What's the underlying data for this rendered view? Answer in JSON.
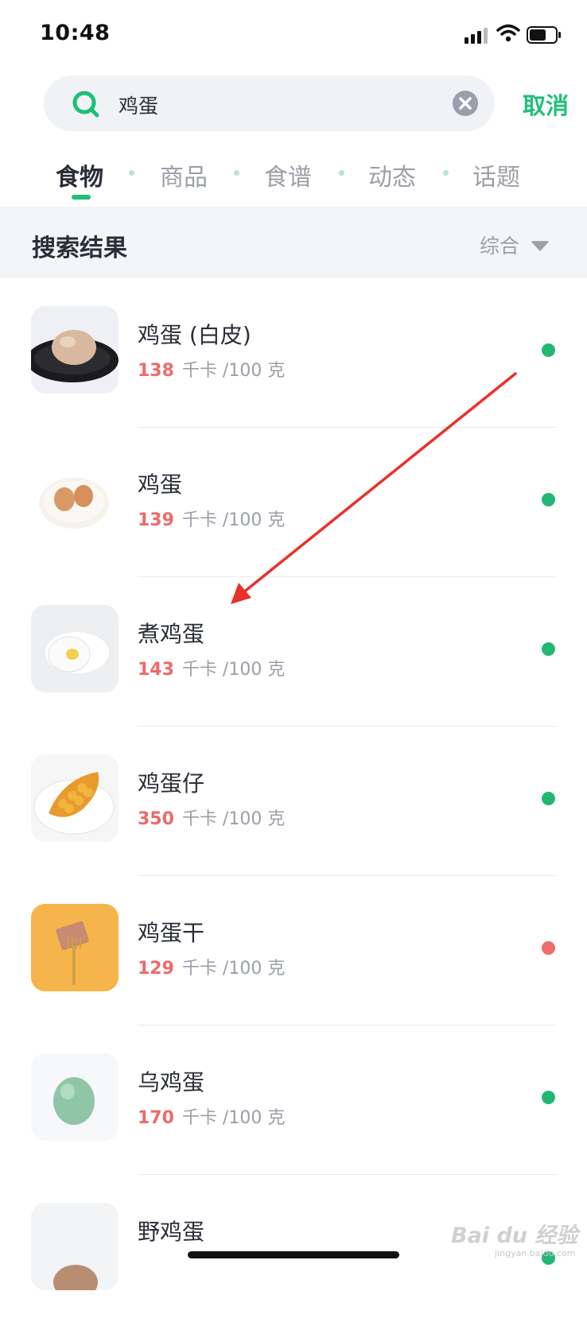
{
  "status_bar": {
    "time": "10:48"
  },
  "search": {
    "query": "鸡蛋",
    "cancel_label": "取消"
  },
  "tabs": [
    {
      "label": "食物",
      "active": true
    },
    {
      "label": "商品",
      "active": false
    },
    {
      "label": "食谱",
      "active": false
    },
    {
      "label": "动态",
      "active": false
    },
    {
      "label": "话题",
      "active": false
    }
  ],
  "results_header": {
    "title": "搜索结果",
    "sort_label": "综合"
  },
  "results": [
    {
      "name": "鸡蛋 (白皮)",
      "kcal": "138",
      "unit": "千卡 /100 克",
      "dot_color": "#22b873"
    },
    {
      "name": "鸡蛋",
      "kcal": "139",
      "unit": "千卡 /100 克",
      "dot_color": "#22b873"
    },
    {
      "name": "煮鸡蛋",
      "kcal": "143",
      "unit": "千卡 /100 克",
      "dot_color": "#22b873"
    },
    {
      "name": "鸡蛋仔",
      "kcal": "350",
      "unit": "千卡 /100 克",
      "dot_color": "#22b873"
    },
    {
      "name": "鸡蛋干",
      "kcal": "129",
      "unit": "千卡 /100 克",
      "dot_color": "#f06b6b"
    },
    {
      "name": "乌鸡蛋",
      "kcal": "170",
      "unit": "千卡 /100 克",
      "dot_color": "#22b873"
    },
    {
      "name": "野鸡蛋",
      "kcal": "",
      "unit": "",
      "dot_color": "#22b873"
    }
  ],
  "watermark": {
    "text": "Bai du 经验",
    "sub": "jingyan.baidu.com"
  },
  "colors": {
    "accent": "#1fbf77",
    "kcal": "#ee6a6a",
    "arrow": "#e8312a"
  }
}
